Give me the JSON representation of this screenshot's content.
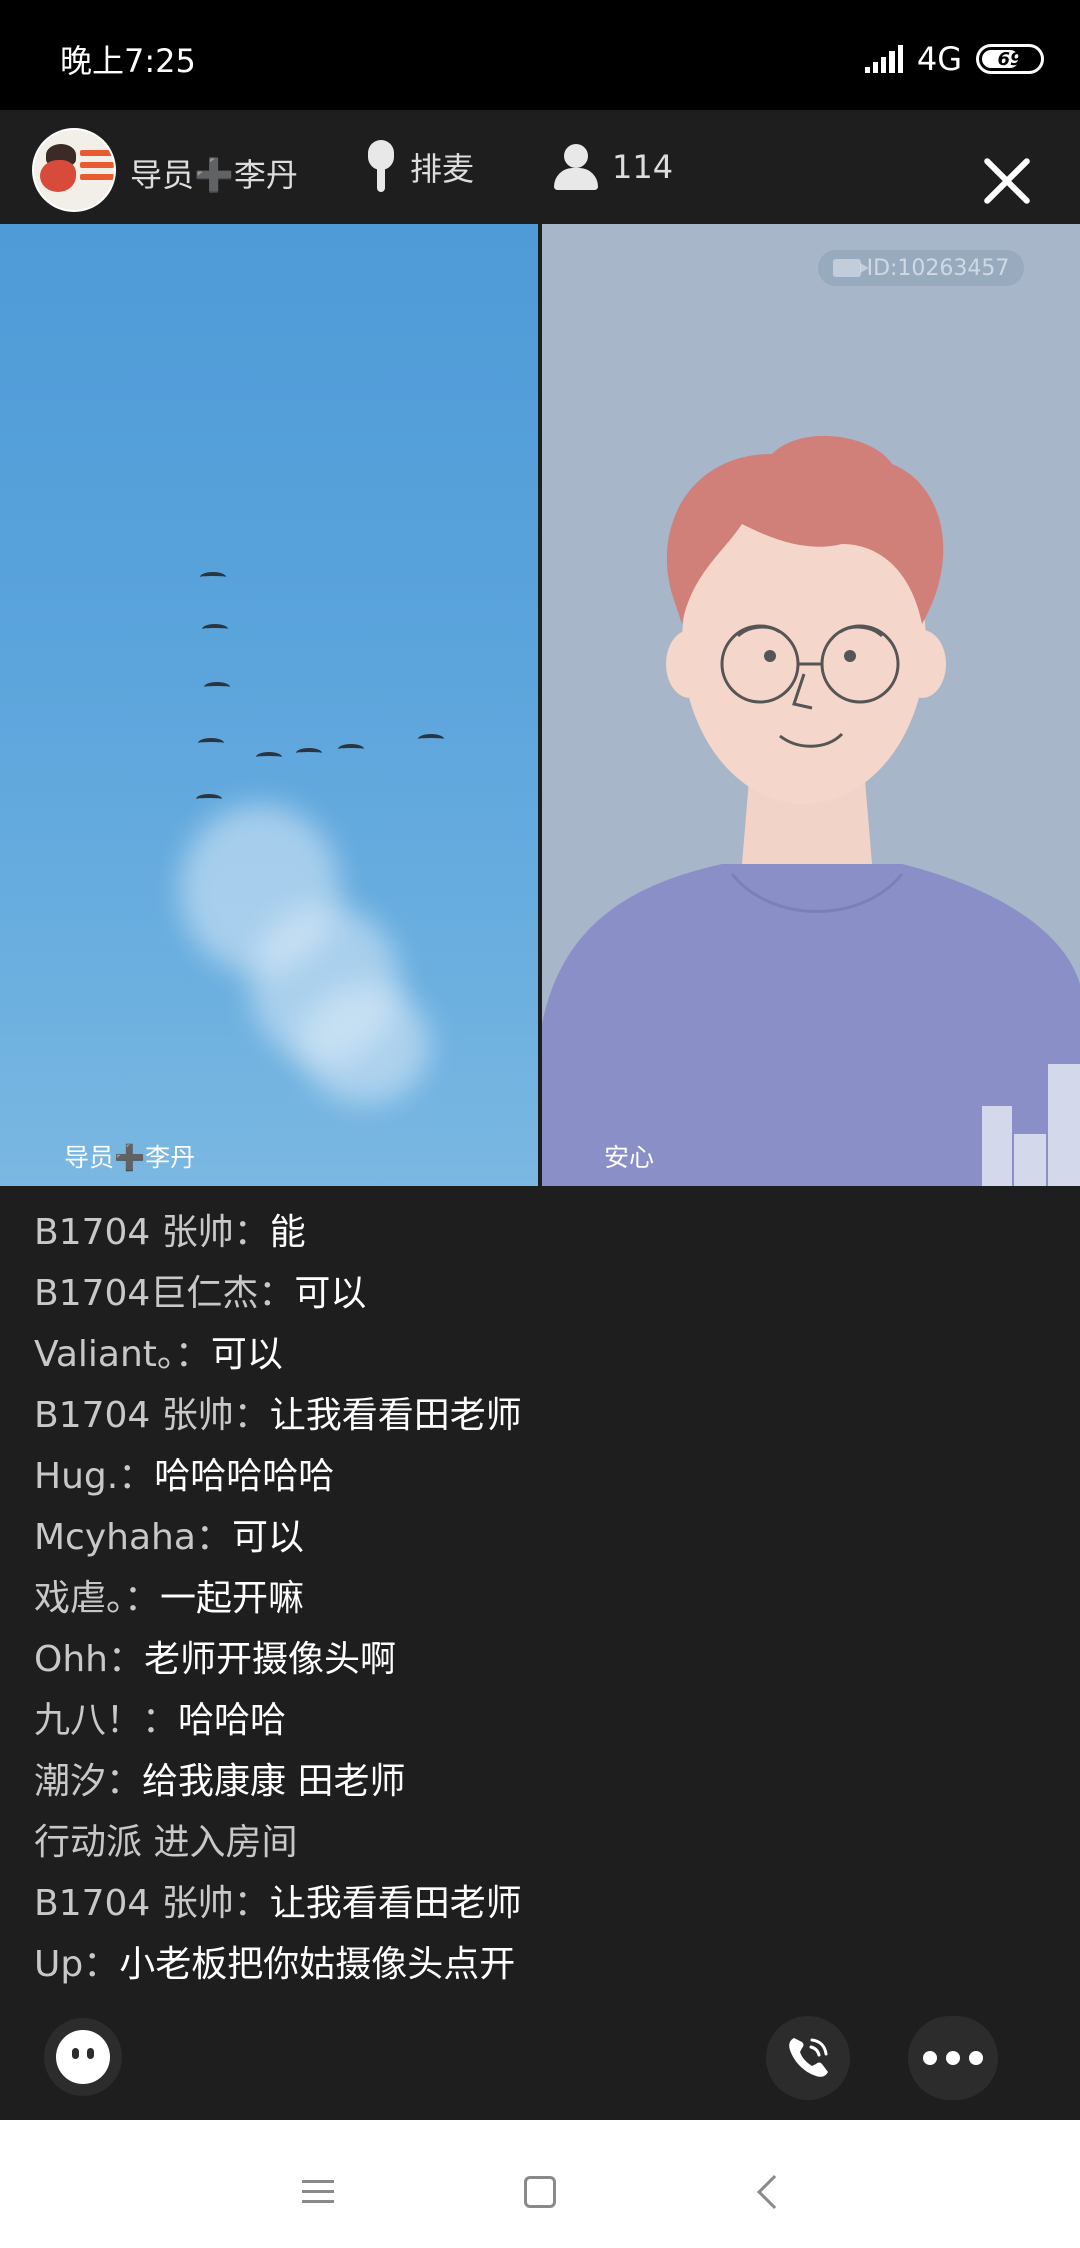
{
  "status_bar": {
    "time": "晚上7:25",
    "network": "4G",
    "battery": "69"
  },
  "header": {
    "host_name": "导员➕李丹",
    "mic_queue_label": "排麦",
    "audience_count": "114"
  },
  "videos": {
    "left_label": "导员➕李丹",
    "right_label": "安心",
    "room_id": "ID:10263457"
  },
  "chat": [
    {
      "sender": "B1704  张帅",
      "text": "能"
    },
    {
      "sender": "B1704巨仁杰",
      "text": "可以"
    },
    {
      "sender": "Valiant。",
      "text": "可以"
    },
    {
      "sender": "B1704  张帅",
      "text": "让我看看田老师"
    },
    {
      "sender": "Hug.",
      "text": "哈哈哈哈哈"
    },
    {
      "sender": "Mcyhaha",
      "text": "可以"
    },
    {
      "sender": "戏虐。",
      "text": "一起开嘛"
    },
    {
      "sender": "Ohh",
      "text": "老师开摄像头啊"
    },
    {
      "sender": "九八！",
      "text": "哈哈哈"
    },
    {
      "sender": "潮汐",
      "text": "给我康康  田老师"
    }
  ],
  "chat_system": "行动派 进入房间",
  "chat_more": [
    {
      "sender": "B1704  张帅",
      "text": "让我看看田老师"
    },
    {
      "sender": "Up",
      "text": "小老板把你姑摄像头点开"
    }
  ],
  "chat_separator": "：",
  "colors": {
    "background": "#1e1e1e",
    "sender_text": "#c8c8c8",
    "message_text": "#ffffff",
    "header_plus": "#f5c518"
  }
}
